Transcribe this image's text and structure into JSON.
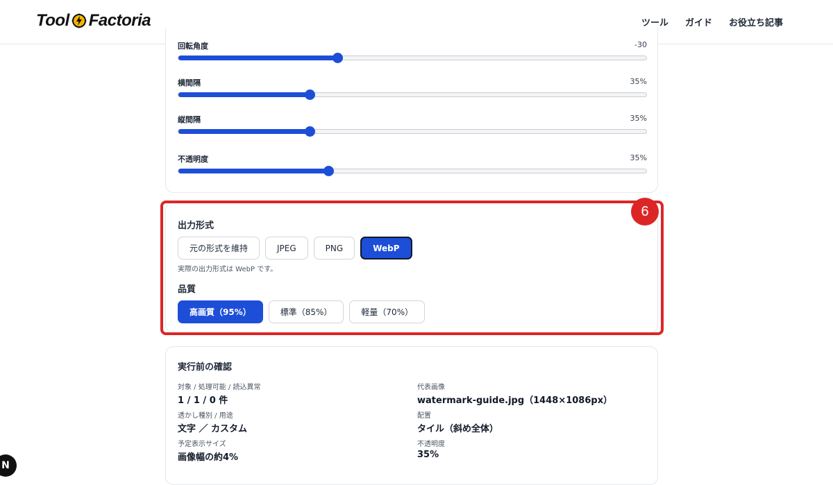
{
  "header": {
    "logo_left": "Tool",
    "logo_right": "Factoria",
    "nav": [
      "ツール",
      "ガイド",
      "お役立ち記事"
    ]
  },
  "sliders": [
    {
      "label": "回転角度",
      "value_text": "-30",
      "fraction": 0.34
    },
    {
      "label": "横間隔",
      "value_text": "35%",
      "fraction": 0.28
    },
    {
      "label": "縦間隔",
      "value_text": "35%",
      "fraction": 0.28
    },
    {
      "label": "不透明度",
      "value_text": "35%",
      "fraction": 0.32
    }
  ],
  "output_format": {
    "title": "出力形式",
    "options": [
      "元の形式を維持",
      "JPEG",
      "PNG",
      "WebP"
    ],
    "selected": "WebP",
    "note": "実際の出力形式は WebP です。"
  },
  "quality": {
    "title": "品質",
    "options": [
      "高画質（95%）",
      "標準（85%）",
      "軽量（70%）"
    ],
    "selected": "高画質（95%）"
  },
  "annotation": {
    "marker": "6",
    "color": "#dc2626"
  },
  "confirm": {
    "title": "実行前の確認",
    "left": [
      {
        "k": "対象 / 処理可能 / 読込異常",
        "v": "1 / 1 / 0 件"
      },
      {
        "k": "透かし種別 / 用途",
        "v": "文字 ／ カスタム"
      },
      {
        "k": "予定表示サイズ",
        "v": "画像幅の約4%"
      }
    ],
    "right": [
      {
        "k": "代表画像",
        "v": "watermark-guide.jpg（1448×1086px）"
      },
      {
        "k": "配置",
        "v": "タイル（斜め全体）"
      },
      {
        "k": "不透明度",
        "v": "35%"
      }
    ]
  },
  "floating_badge": "N",
  "colors": {
    "accent": "#1d4ed8",
    "highlight": "#dc2626"
  }
}
